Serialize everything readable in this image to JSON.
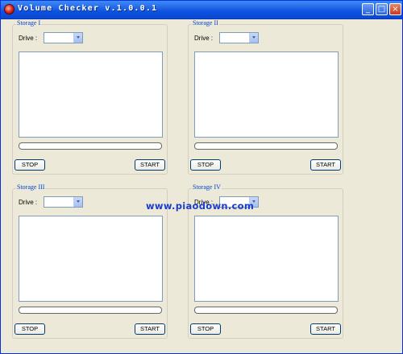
{
  "window": {
    "title": "Volume Checker v.1.0.0.1",
    "controls": {
      "minimize": "_",
      "maximize": "□",
      "close": "×"
    }
  },
  "storages": [
    {
      "title": "Storage I",
      "drive_label": "Drive :",
      "drive_value": "",
      "log_text": "",
      "progress": 0,
      "stop_label": "STOP",
      "start_label": "START"
    },
    {
      "title": "Storage II",
      "drive_label": "Drive :",
      "drive_value": "",
      "log_text": "",
      "progress": 0,
      "stop_label": "STOP",
      "start_label": "START"
    },
    {
      "title": "Storage III",
      "drive_label": "Drive :",
      "drive_value": "",
      "log_text": "",
      "progress": 0,
      "stop_label": "STOP",
      "start_label": "START"
    },
    {
      "title": "Storage IV",
      "drive_label": "Drive :",
      "drive_value": "",
      "log_text": "",
      "progress": 0,
      "stop_label": "STOP",
      "start_label": "START"
    }
  ],
  "watermark": "www.piaodown.com"
}
